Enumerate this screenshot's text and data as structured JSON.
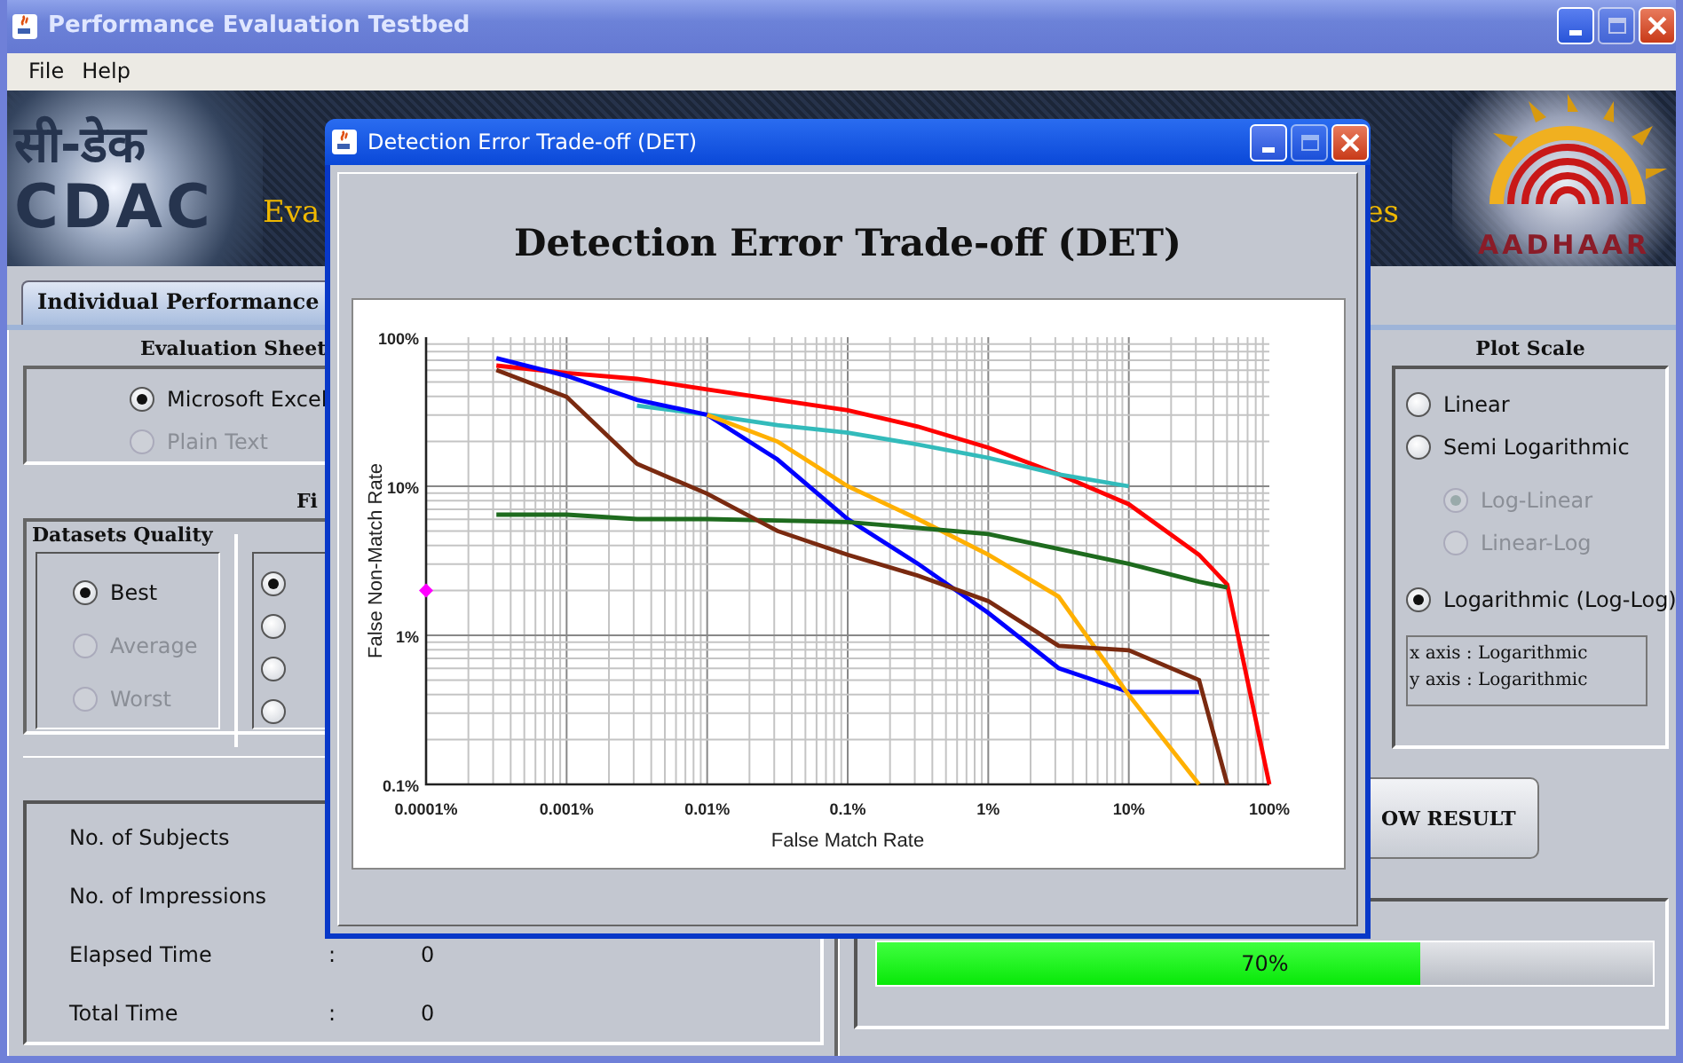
{
  "window": {
    "title": "Performance Evaluation Testbed"
  },
  "menu": [
    "File",
    "Help"
  ],
  "banner": {
    "left_logo": [
      "सी-डेक",
      "CDAC"
    ],
    "heading_parts": [
      "Eva",
      "es"
    ],
    "right_logo": "AADHAAR"
  },
  "tabs": [
    {
      "label": "Individual Performance",
      "selected": true
    }
  ],
  "evaluation_sheet": {
    "title": "Evaluation Sheet",
    "options": [
      {
        "label": "Microsoft Excel",
        "selected": true,
        "disabled": false
      },
      {
        "label": "Plain Text",
        "selected": false,
        "disabled": true
      }
    ]
  },
  "fingerprint_group": {
    "title": "Fi",
    "datasets_quality": {
      "title": "Datasets Quality",
      "options": [
        {
          "label": "Best",
          "selected": true,
          "disabled": false
        },
        {
          "label": "Average",
          "selected": false,
          "disabled": true
        },
        {
          "label": "Worst",
          "selected": false,
          "disabled": true
        }
      ]
    },
    "options": [
      {
        "selected": true
      },
      {
        "selected": false
      },
      {
        "selected": false
      },
      {
        "selected": false
      }
    ]
  },
  "stats": [
    {
      "label": "No. of Subjects"
    },
    {
      "label": "No. of Impressions"
    },
    {
      "label": "Elapsed Time",
      "separator": ":",
      "value": "0"
    },
    {
      "label": "Total Time",
      "separator": ":",
      "value": "0"
    }
  ],
  "plot_scale": {
    "title": "Plot Scale",
    "options": [
      {
        "label": "Linear",
        "selected": false,
        "disabled": false
      },
      {
        "label": "Semi Logarithmic",
        "selected": false,
        "disabled": false,
        "children": [
          {
            "label": "Log-Linear",
            "selected": true,
            "disabled": true
          },
          {
            "label": "Linear-Log",
            "selected": false,
            "disabled": true
          }
        ]
      },
      {
        "label": "Logarithmic (Log-Log)",
        "selected": true,
        "disabled": false
      }
    ],
    "axis_info": [
      "x axis : Logarithmic",
      "y axis : Logarithmic"
    ]
  },
  "show_result_button": "OW RESULT",
  "progress": {
    "level": 0.7,
    "text": "70%"
  },
  "dialog": {
    "title": "Detection Error Trade-off (DET)",
    "heading": "Detection Error Trade-off (DET)",
    "chart": {
      "xlabel": "False Match Rate",
      "ylabel": "False Non-Match Rate",
      "x_tick_labels": [
        "0.0001%",
        "0.001%",
        "0.01%",
        "0.1%",
        "1%",
        "10%",
        "100%"
      ],
      "y_tick_labels": [
        "100%",
        "10%",
        "1%",
        "0.1%"
      ],
      "curves": [
        {
          "color": "#ff0000"
        },
        {
          "color": "#33bbbb"
        },
        {
          "color": "#0000ff"
        },
        {
          "color": "#ffb000"
        },
        {
          "color": "#1e6b1e"
        },
        {
          "color": "#7a2a10"
        },
        {
          "color": "#ff00ff"
        }
      ]
    }
  }
}
